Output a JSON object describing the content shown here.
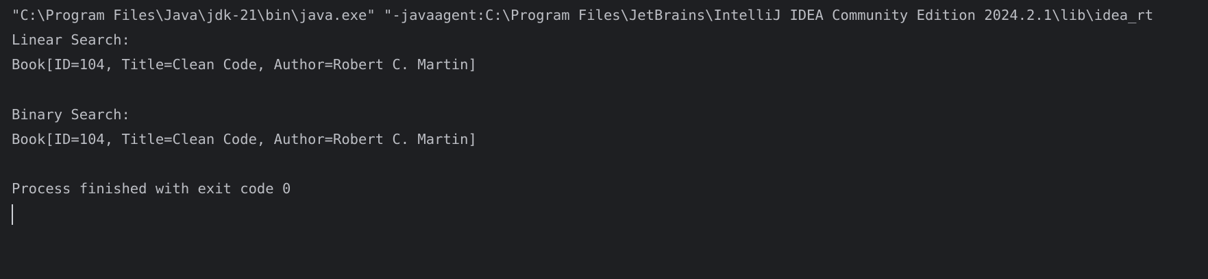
{
  "console": {
    "command_line": "\"C:\\Program Files\\Java\\jdk-21\\bin\\java.exe\" \"-javaagent:C:\\Program Files\\JetBrains\\IntelliJ IDEA Community Edition 2024.2.1\\lib\\idea_rt",
    "output": [
      "Linear Search:",
      "Book[ID=104, Title=Clean Code, Author=Robert C. Martin]",
      "",
      "Binary Search:",
      "Book[ID=104, Title=Clean Code, Author=Robert C. Martin]",
      "",
      "Process finished with exit code 0"
    ]
  },
  "colors": {
    "background": "#1e1f22",
    "text": "#bcbec4",
    "caret": "#ced0d6"
  }
}
